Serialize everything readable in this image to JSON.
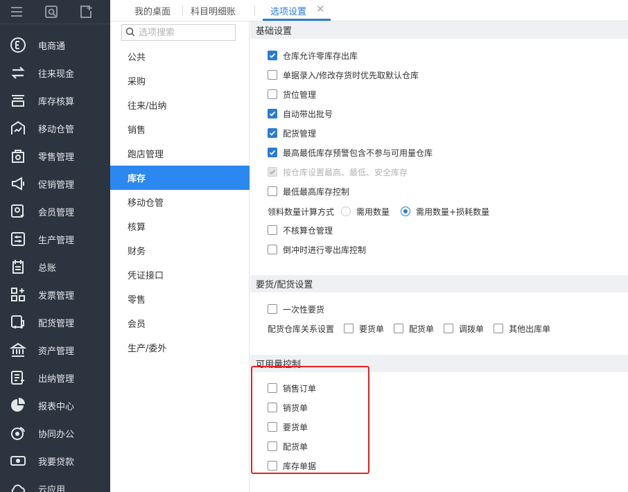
{
  "tabs": [
    {
      "label": "我的桌面"
    },
    {
      "label": "科目明细账"
    },
    {
      "label": "选项设置",
      "active": true
    }
  ],
  "sidebar": {
    "items": [
      {
        "label": "电商通",
        "icon": "e-commerce-icon"
      },
      {
        "label": "往来现金",
        "icon": "exchange-icon"
      },
      {
        "label": "库存核算",
        "icon": "inventory-icon"
      },
      {
        "label": "移动仓管",
        "icon": "mobile-warehouse-icon"
      },
      {
        "label": "零售管理",
        "icon": "retail-icon"
      },
      {
        "label": "促销管理",
        "icon": "megaphone-icon"
      },
      {
        "label": "会员管理",
        "icon": "member-icon"
      },
      {
        "label": "生产管理",
        "icon": "production-icon"
      },
      {
        "label": "总账",
        "icon": "ledger-icon"
      },
      {
        "label": "发票管理",
        "icon": "invoice-icon"
      },
      {
        "label": "配货管理",
        "icon": "delivery-icon"
      },
      {
        "label": "资产管理",
        "icon": "bank-icon"
      },
      {
        "label": "出纳管理",
        "icon": "cashier-icon"
      },
      {
        "label": "报表中心",
        "icon": "pie-chart-icon"
      },
      {
        "label": "协同办公",
        "icon": "collaboration-icon"
      },
      {
        "label": "我要贷款",
        "icon": "loan-icon"
      },
      {
        "label": "云应用",
        "icon": "cloud-icon"
      }
    ]
  },
  "search": {
    "placeholder": "选项搜索"
  },
  "categories": [
    {
      "label": "公共"
    },
    {
      "label": "采购"
    },
    {
      "label": "往来/出纳"
    },
    {
      "label": "销售"
    },
    {
      "label": "跑店管理"
    },
    {
      "label": "库存",
      "active": true
    },
    {
      "label": "移动仓管"
    },
    {
      "label": "核算"
    },
    {
      "label": "财务"
    },
    {
      "label": "凭证接口"
    },
    {
      "label": "零售"
    },
    {
      "label": "会员"
    },
    {
      "label": "生产/委外"
    }
  ],
  "basic": {
    "title": "基础设置",
    "options": [
      {
        "label": "仓库允许零库存出库",
        "checked": true
      },
      {
        "label": "单据录入/修改存货时优先取默认仓库",
        "checked": false
      },
      {
        "label": "货位管理",
        "checked": false
      },
      {
        "label": "自动带出批号",
        "checked": true
      },
      {
        "label": "配货管理",
        "checked": true
      },
      {
        "label": "最高最低库存预警包含不参与可用量仓库",
        "checked": true
      },
      {
        "label": "按仓库设置最高、最低、安全库存",
        "checked": true,
        "disabled": true
      },
      {
        "label": "最低最高库存控制",
        "checked": false
      }
    ],
    "calc": {
      "label": "领料数量计算方式",
      "option1": "需用数量",
      "option2": "需用数量+损耗数量",
      "selected": "需用数量+损耗数量"
    },
    "options2": [
      {
        "label": "不核算仓管理",
        "checked": false
      },
      {
        "label": "倒冲时进行零出库控制",
        "checked": false
      }
    ]
  },
  "requisition": {
    "title": "要货/配货设置",
    "once": {
      "label": "一次性要货",
      "checked": false
    },
    "relation": {
      "label": "配货仓库关系设置",
      "items": [
        {
          "label": "要货单",
          "checked": false
        },
        {
          "label": "配货单",
          "checked": false
        },
        {
          "label": "调拨单",
          "checked": false
        },
        {
          "label": "其他出库单",
          "checked": false
        }
      ]
    }
  },
  "availability": {
    "title": "可用量控制",
    "options": [
      {
        "label": "销售订单",
        "checked": false
      },
      {
        "label": "销货单",
        "checked": false
      },
      {
        "label": "要货单",
        "checked": false
      },
      {
        "label": "配货单",
        "checked": false
      },
      {
        "label": "库存单据",
        "checked": false
      }
    ]
  },
  "colors": {
    "accent": "#2b7bd6",
    "nav_active": "#2b88f0",
    "sidebar_bg": "#2c3440",
    "highlight": "#e52020"
  }
}
